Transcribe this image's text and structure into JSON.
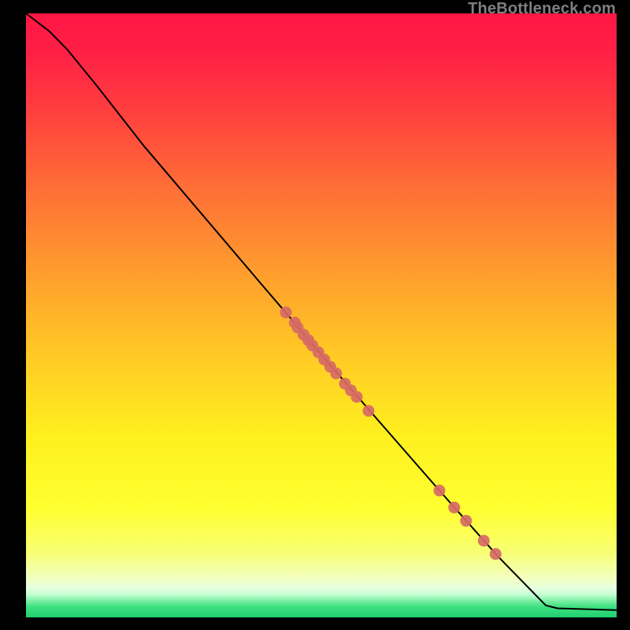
{
  "watermark": "TheBottleneck.com",
  "chart_data": {
    "type": "line",
    "title": "",
    "xlabel": "",
    "ylabel": "",
    "xlim": [
      0,
      100
    ],
    "ylim": [
      0,
      100
    ],
    "curve": [
      {
        "x": 0,
        "y": 100
      },
      {
        "x": 2,
        "y": 98.5
      },
      {
        "x": 4,
        "y": 97
      },
      {
        "x": 7,
        "y": 94
      },
      {
        "x": 12,
        "y": 88
      },
      {
        "x": 20,
        "y": 78
      },
      {
        "x": 30,
        "y": 66.5
      },
      {
        "x": 40,
        "y": 55
      },
      {
        "x": 45,
        "y": 49.3
      },
      {
        "x": 50,
        "y": 43.5
      },
      {
        "x": 60,
        "y": 32.2
      },
      {
        "x": 70,
        "y": 21
      },
      {
        "x": 80,
        "y": 10
      },
      {
        "x": 88,
        "y": 2
      },
      {
        "x": 90,
        "y": 1.5
      },
      {
        "x": 100,
        "y": 1.2
      }
    ],
    "points": [
      {
        "x": 44.0,
        "y": 50.5
      },
      {
        "x": 45.5,
        "y": 48.8
      },
      {
        "x": 46.0,
        "y": 48.0
      },
      {
        "x": 47.0,
        "y": 46.8
      },
      {
        "x": 47.8,
        "y": 45.9
      },
      {
        "x": 48.5,
        "y": 45.0
      },
      {
        "x": 49.5,
        "y": 43.9
      },
      {
        "x": 50.5,
        "y": 42.7
      },
      {
        "x": 51.5,
        "y": 41.5
      },
      {
        "x": 52.5,
        "y": 40.4
      },
      {
        "x": 54.0,
        "y": 38.7
      },
      {
        "x": 55.0,
        "y": 37.6
      },
      {
        "x": 56.0,
        "y": 36.5
      },
      {
        "x": 58.0,
        "y": 34.2
      },
      {
        "x": 70.0,
        "y": 21.0
      },
      {
        "x": 72.5,
        "y": 18.2
      },
      {
        "x": 74.5,
        "y": 16.0
      },
      {
        "x": 77.5,
        "y": 12.7
      },
      {
        "x": 79.5,
        "y": 10.5
      }
    ],
    "point_color": "#d66a65",
    "line_color": "#000000",
    "gradient_stops": [
      {
        "offset": 0.0,
        "color": "#ff1744"
      },
      {
        "offset": 0.06,
        "color": "#ff1f46"
      },
      {
        "offset": 0.15,
        "color": "#ff3b3f"
      },
      {
        "offset": 0.28,
        "color": "#ff6b37"
      },
      {
        "offset": 0.42,
        "color": "#ff9a2e"
      },
      {
        "offset": 0.56,
        "color": "#ffc825"
      },
      {
        "offset": 0.7,
        "color": "#fff01f"
      },
      {
        "offset": 0.82,
        "color": "#ffff30"
      },
      {
        "offset": 0.89,
        "color": "#f8ff70"
      },
      {
        "offset": 0.935,
        "color": "#f2ffc0"
      },
      {
        "offset": 0.952,
        "color": "#e6ffe0"
      },
      {
        "offset": 0.963,
        "color": "#c0ffd0"
      },
      {
        "offset": 0.972,
        "color": "#80f0a8"
      },
      {
        "offset": 0.982,
        "color": "#40e080"
      },
      {
        "offset": 1.0,
        "color": "#1fd070"
      }
    ]
  }
}
